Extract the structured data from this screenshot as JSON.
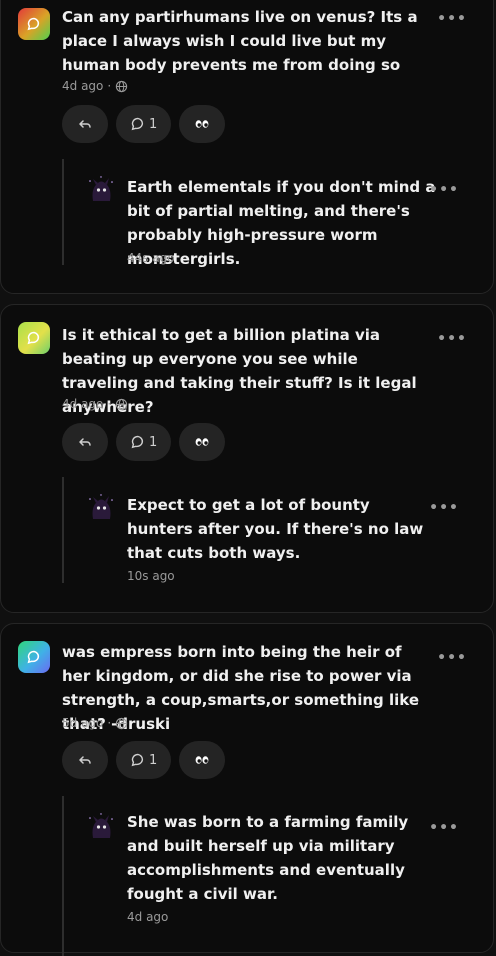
{
  "posts": [
    {
      "question": "Can any partirhumans live on venus? Its a place I always wish I could live but my human body prevents me from doing so",
      "time": "4d ago",
      "comment_count": "1",
      "reply": {
        "text": "Earth elementals if you don't mind a bit of partial melting, and there's probably high-pressure worm monstergirls.",
        "time": "44s ago"
      }
    },
    {
      "question": "Is it ethical to get a billion platina via beating up everyone you see while traveling and taking their stuff? Is it legal anywhere?",
      "time": "4d ago",
      "comment_count": "1",
      "reply": {
        "text": "Expect to get a lot of bounty hunters after you. If there's no law that cuts both ways.",
        "time": "10s ago"
      }
    },
    {
      "question": "was empress born into being the heir of her kingdom, or did she rise to power via strength, a coup,smarts,or something like that? -druski",
      "time": "5d ago",
      "comment_count": "1",
      "reply": {
        "text": "She was born to a farming family and built herself up via military accomplishments and eventually fought a civil war.",
        "time": "4d ago"
      }
    }
  ],
  "ui": {
    "more_glyph": "•••",
    "meta_separator": "·"
  },
  "icons": {
    "question_icon": "speech-bubble-icon",
    "visibility": "globe-icon",
    "reply_action": "reply-arrow-icon",
    "comment_action": "comment-icon",
    "reaction_action": "eyes-icon",
    "reply_avatar": "shadow-creature-avatar"
  },
  "colors": {
    "background": "#101010",
    "card": "#0c0c0c",
    "pill": "#242424",
    "muted_text": "#9a9a9a"
  }
}
